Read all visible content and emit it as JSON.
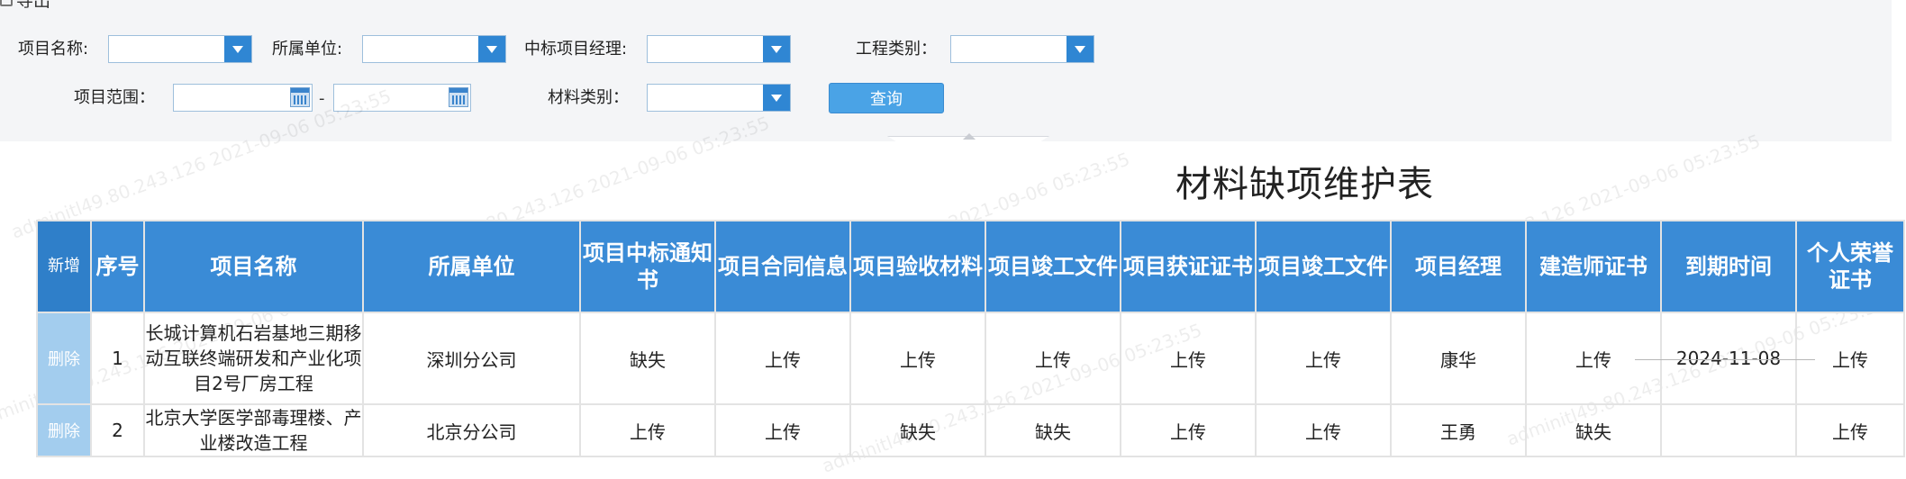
{
  "toolbar": {
    "export_label": "导出"
  },
  "filters": {
    "project_name_label": "项目名称:",
    "unit_label": "所属单位:",
    "manager_label": "中标项目经理:",
    "category_label": "工程类别：",
    "range_label": "项目范围：",
    "range_separator": "-",
    "material_label": "材料类别：",
    "query_label": "查询"
  },
  "report": {
    "title": "材料缺项维护表"
  },
  "table": {
    "add_label": "新增",
    "headers": [
      "序号",
      "项目名称",
      "所属单位",
      "项目中标通知书",
      "项目合同信息",
      "项目验收材料",
      "项目竣工文件",
      "项目获证证书",
      "项目竣工文件",
      "项目经理",
      "建造师证书",
      "到期时间",
      "个人荣誉证书"
    ],
    "delete_label": "删除",
    "rows": [
      {
        "seq": "1",
        "name": "长城计算机石岩基地三期移动互联终端研发和产业化项目2号厂房工程",
        "unit": "深圳分公司",
        "cells": [
          "缺失",
          "上传",
          "上传",
          "上传",
          "上传",
          "上传"
        ],
        "manager": "康华",
        "builder_cert": "上传",
        "expiry": "2024-11-08",
        "honor": "上传"
      },
      {
        "seq": "2",
        "name": "北京大学医学部毒理楼、产业楼改造工程",
        "unit": "北京分公司",
        "cells": [
          "上传",
          "上传",
          "缺失",
          "缺失",
          "上传",
          "上传"
        ],
        "manager": "王勇",
        "builder_cert": "缺失",
        "expiry": "",
        "honor": "上传"
      }
    ]
  },
  "watermark": "adminitl49.80.243.126 2021-09-06 05:23:55",
  "colors": {
    "header_blue": "#3a8bd6",
    "missing_red": "#e5141b",
    "delete_bg": "#a3cdee",
    "query_button": "#4aa3e6"
  }
}
